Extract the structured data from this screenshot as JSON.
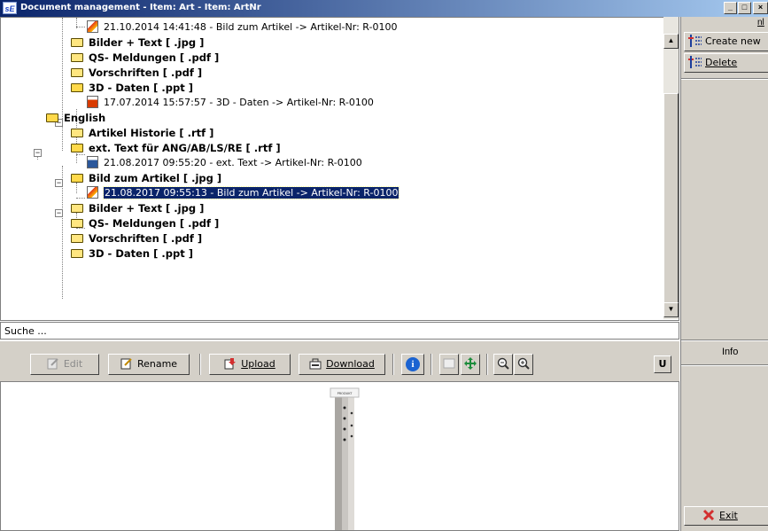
{
  "window": {
    "app_icon": "sE",
    "title": "Document management - Item: Art - Item: ArtNr",
    "controls": {
      "minimize": "_",
      "maximize": "□",
      "close": "×"
    }
  },
  "tree": {
    "rows": [
      {
        "type": "file",
        "icon": "image-file-icon",
        "text": "21.10.2014 14:41:48 - Bild zum Artikel -> Artikel-Nr: R-0100"
      },
      {
        "type": "folder",
        "text": "Bilder + Text [ .jpg ]"
      },
      {
        "type": "folder",
        "text": "QS- Meldungen [ .pdf ]"
      },
      {
        "type": "folder",
        "text": "Vorschriften [ .pdf ]"
      },
      {
        "type": "folder-open",
        "text": "3D - Daten [ .ppt ]"
      },
      {
        "type": "file",
        "icon": "ppt-file-icon",
        "text": "17.07.2014 15:57:57 - 3D - Daten -> Artikel-Nr: R-0100"
      },
      {
        "type": "folder-open",
        "text": "English"
      },
      {
        "type": "folder",
        "text": "Artikel Historie [ .rtf ]"
      },
      {
        "type": "folder-open",
        "text": "ext. Text für ANG/AB/LS/RE [ .rtf ]"
      },
      {
        "type": "file",
        "icon": "word-file-icon",
        "text": "21.08.2017 09:55:20 - ext. Text -> Artikel-Nr: R-0100"
      },
      {
        "type": "folder-open",
        "text": "Bild zum Artikel [ .jpg ]"
      },
      {
        "type": "file",
        "icon": "image-file-icon",
        "text": "21.08.2017 09:55:13 - Bild zum Artikel -> Artikel-Nr: R-0100",
        "selected": true
      },
      {
        "type": "folder",
        "text": "Bilder + Text [ .jpg ]"
      },
      {
        "type": "folder",
        "text": "QS- Meldungen [ .pdf ]"
      },
      {
        "type": "folder",
        "text": "Vorschriften [ .pdf ]"
      },
      {
        "type": "folder",
        "text": "3D - Daten [ .ppt ]"
      }
    ]
  },
  "search": {
    "value": "Suche ..."
  },
  "toolbar": {
    "edit": "Edit",
    "rename": "Rename",
    "upload": "Upload",
    "download": "Download",
    "info_glyph": "i",
    "u_button": "U"
  },
  "right_panel": {
    "top_link": "nl",
    "create_new": "Create new",
    "delete": "Delete",
    "info": "Info",
    "exit": "Exit"
  },
  "preview": {
    "product_label": "PRODUKT"
  },
  "colors": {
    "selection": "#0a246a",
    "title_start": "#0a246a",
    "title_end": "#a6caf0"
  }
}
